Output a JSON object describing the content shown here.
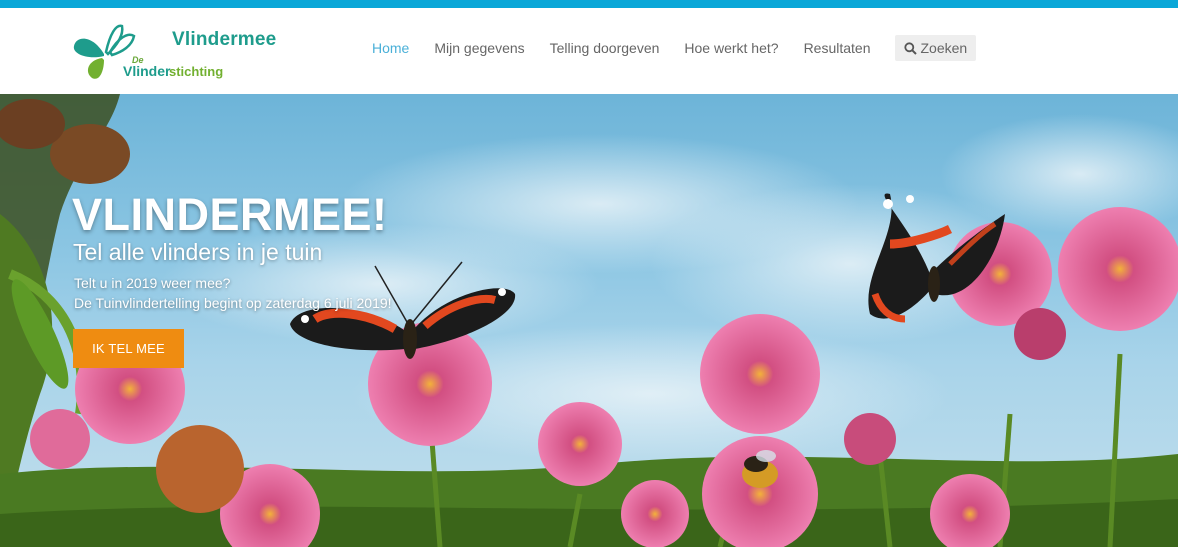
{
  "colors": {
    "top_strip": "#0aa7d8",
    "brand_teal": "#1e9c8c",
    "brand_green": "#72b030",
    "nav_active": "#4ab0d8",
    "cta": "#ef8c11"
  },
  "logo": {
    "title": "Vlindermee",
    "de": "De",
    "sub_strong": "Vlinder",
    "sub_light": "stichting",
    "icon": "butterfly-logo-icon"
  },
  "nav": {
    "items": [
      {
        "label": "Home",
        "active": true
      },
      {
        "label": "Mijn gegevens",
        "active": false
      },
      {
        "label": "Telling doorgeven",
        "active": false
      },
      {
        "label": "Hoe werkt het?",
        "active": false
      },
      {
        "label": "Resultaten",
        "active": false
      }
    ],
    "search_label": "Zoeken",
    "search_icon": "search-icon"
  },
  "hero": {
    "title": "VLINDERMEE!",
    "subtitle": "Tel alle vlinders in je tuin",
    "line1": "Telt u in 2019 weer mee?",
    "line2": "De Tuinvlindertelling begint op zaterdag 6 juli 2019!",
    "cta_label": "IK TEL MEE"
  }
}
